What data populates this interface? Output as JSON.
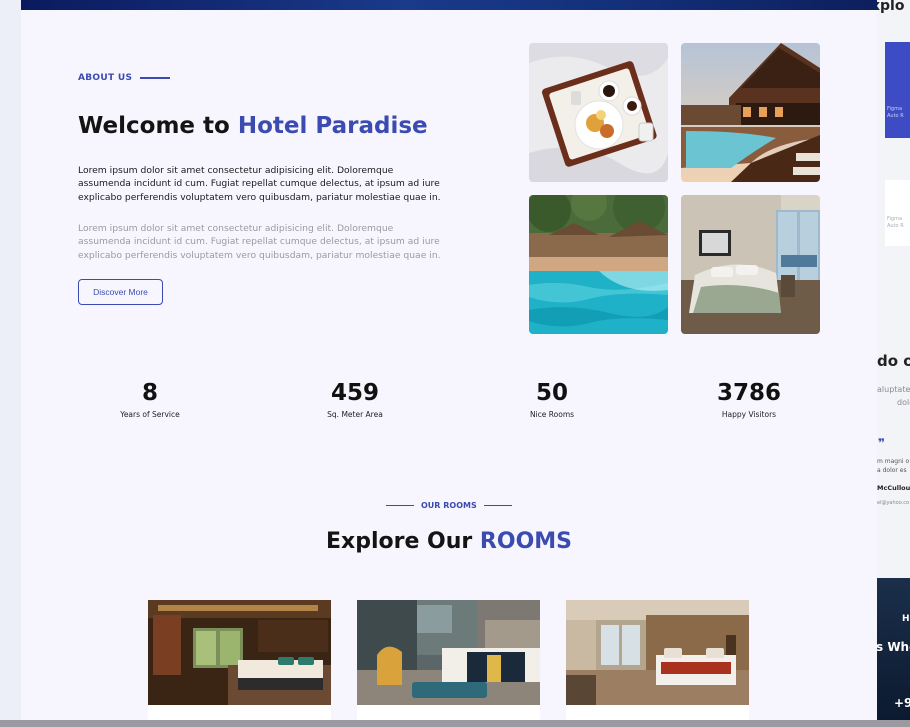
{
  "about": {
    "eyebrow": "ABOUT US",
    "title_prefix": "Welcome to",
    "title_accent": "Hotel Paradise",
    "paragraph_1": "Lorem ipsum dolor sit amet consectetur adipisicing elit. Doloremque assumenda incidunt id cum. Fugiat repellat cumque delectus, at ipsum ad iure explicabo perferendis voluptatem vero quibusdam, pariatur molestiae quae in.",
    "paragraph_2": "Lorem ipsum dolor sit amet consectetur adipisicing elit. Doloremque assumenda incidunt id cum. Fugiat repellat cumque delectus, at ipsum ad iure explicabo perferendis voluptatem vero quibusdam, pariatur molestiae quae in.",
    "cta_label": "Discover More"
  },
  "gallery": [
    {
      "name": "breakfast-tray-image"
    },
    {
      "name": "resort-pool-image"
    },
    {
      "name": "garden-pool-image"
    },
    {
      "name": "bedroom-image"
    }
  ],
  "stats": [
    {
      "value": "8",
      "label": "Years of Service"
    },
    {
      "value": "459",
      "label": "Sq. Meter Area"
    },
    {
      "value": "50",
      "label": "Nice Rooms"
    },
    {
      "value": "3786",
      "label": "Happy Visitors"
    }
  ],
  "rooms": {
    "eyebrow": "OUR ROOMS",
    "title_prefix": "Explore Our",
    "title_accent": "ROOMS"
  },
  "right_panel": {
    "heading_fragment": "xplo",
    "card_text_1": "Figma",
    "card_text_2": "Auto R",
    "card_text_3": "Figma",
    "card_text_4": "Auto R",
    "section_fragment": "do o",
    "gray_line_1": "aluptate",
    "gray_line_2": "dolo",
    "quote_mark": "❞",
    "review_line_1": "m magni o",
    "review_line_2": "a dolor es",
    "reviewer_name": "McCullou",
    "reviewer_email": "el@yahoo.co",
    "dark_text_1": "H",
    "dark_text_2": "s Whe",
    "dark_text_3": "+9"
  },
  "colors": {
    "accent": "#3b4bb0",
    "background": "#f7f6fe",
    "text": "#141414",
    "muted": "#9a9aa4"
  }
}
